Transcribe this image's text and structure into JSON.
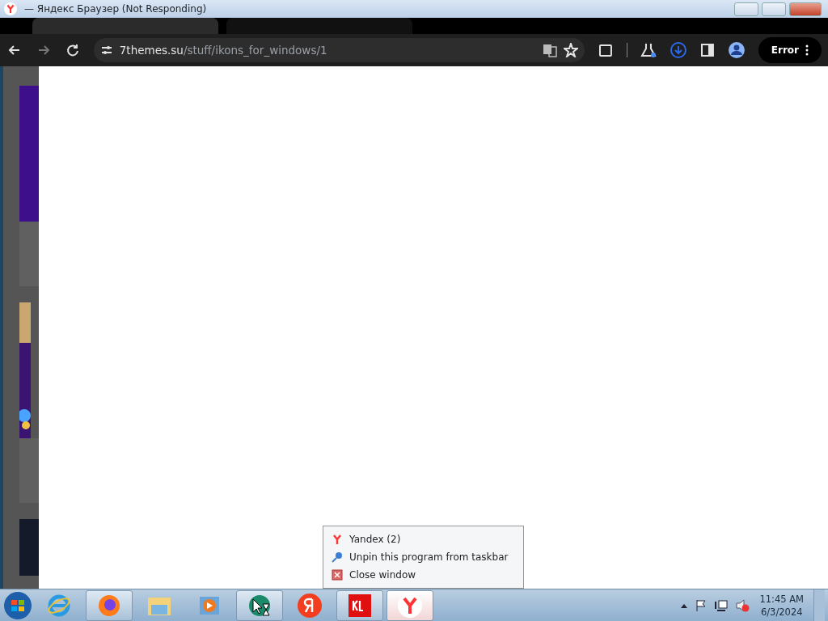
{
  "window": {
    "title": "— Яндекс Браузер (Not Responding)"
  },
  "address_bar": {
    "host": "7themes.su",
    "path": "/stuff/ikons_for_windows/1"
  },
  "profile_button": {
    "label": "Error"
  },
  "context_menu": {
    "items": [
      {
        "label": "Yandex (2)",
        "kind": "app"
      },
      {
        "label": "Unpin this program from taskbar",
        "kind": "unpin"
      },
      {
        "label": "Close window",
        "kind": "close"
      }
    ]
  },
  "taskbar": {
    "items": [
      {
        "kind": "ie",
        "running": false,
        "selected": false
      },
      {
        "kind": "firefox",
        "running": true,
        "selected": false
      },
      {
        "kind": "explorer",
        "running": false,
        "selected": false
      },
      {
        "kind": "media",
        "running": false,
        "selected": false
      },
      {
        "kind": "globe",
        "running": true,
        "selected": false
      },
      {
        "kind": "ya",
        "running": false,
        "selected": false
      },
      {
        "kind": "kl",
        "running": true,
        "selected": false
      },
      {
        "kind": "yandex",
        "running": true,
        "selected": true
      }
    ]
  },
  "clock": {
    "time": "11:45 AM",
    "date": "6/3/2024"
  }
}
